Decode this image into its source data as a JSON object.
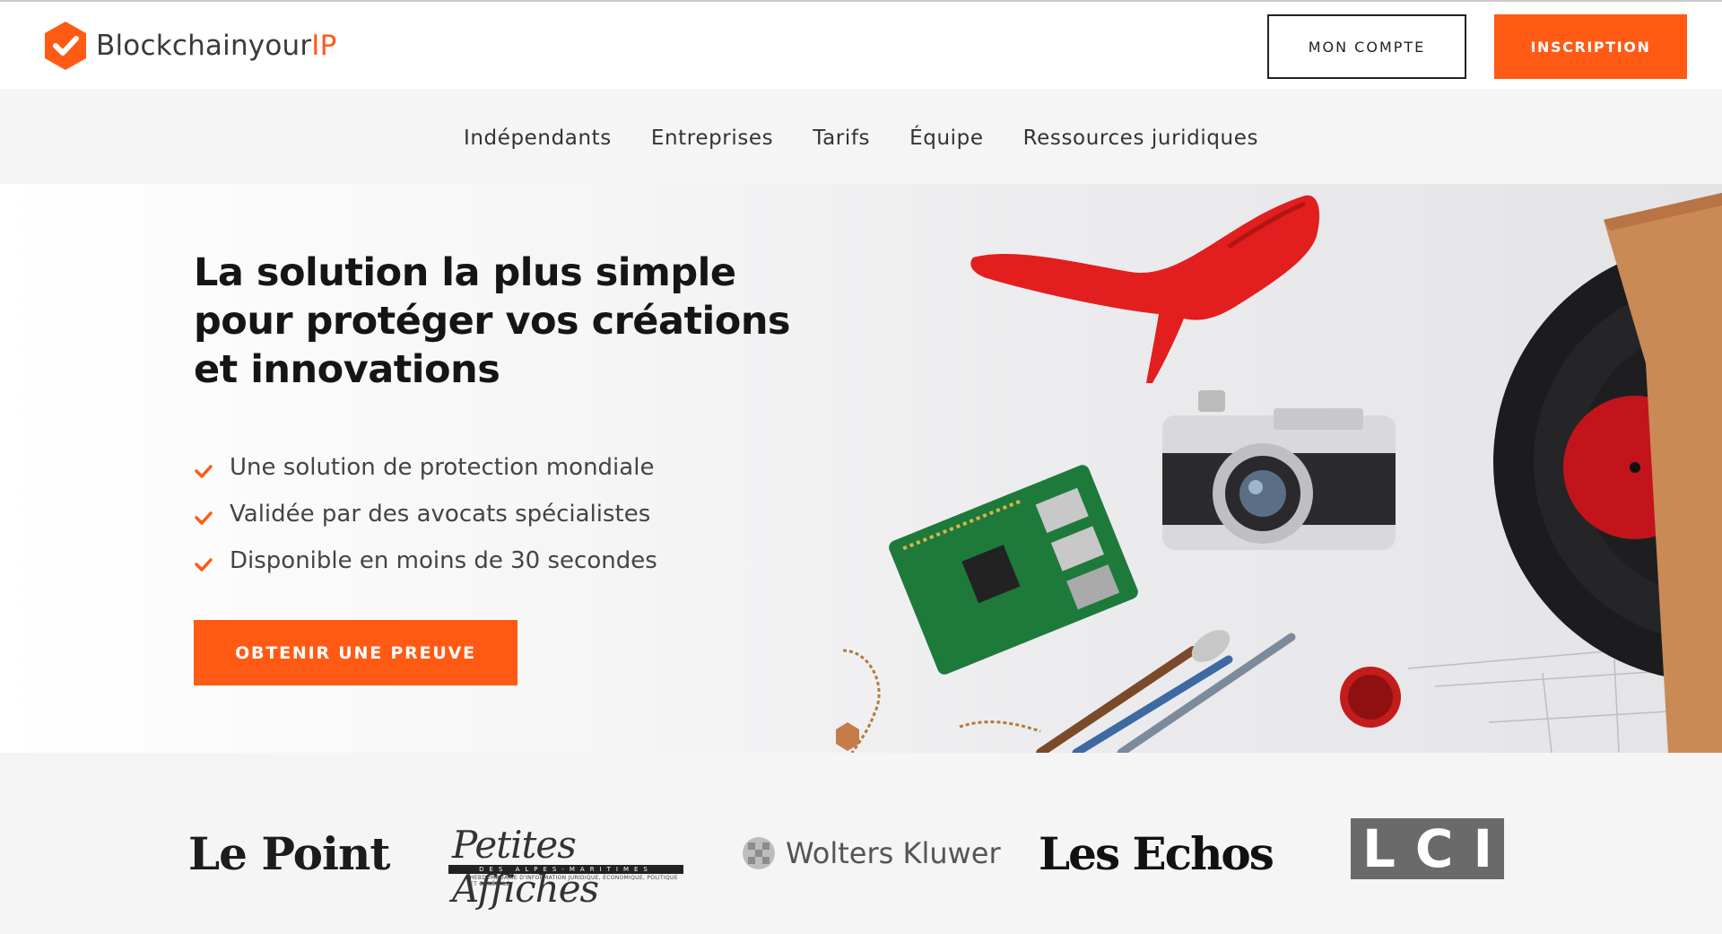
{
  "brand": {
    "name_main": "Blockchainyour",
    "name_accent": "IP",
    "accent_color": "#ff5a14"
  },
  "header": {
    "account_label": "MON COMPTE",
    "signup_label": "INSCRIPTION"
  },
  "nav": {
    "items": [
      "Indépendants",
      "Entreprises",
      "Tarifs",
      "Équipe",
      "Ressources juridiques"
    ]
  },
  "hero": {
    "title": "La solution la plus simple pour protéger vos créations et innovations",
    "features": [
      "Une solution de protection mondiale",
      "Validée par des avocats spécialistes",
      "Disponible en moins de 30 secondes"
    ],
    "cta_label": "OBTENIR UNE PREUVE"
  },
  "press": {
    "logos": [
      "Le Point",
      "Petites Affiches",
      "Wolters Kluwer",
      "Les Echos",
      "LCI"
    ],
    "petites_affiches_main": "Petites Affiches",
    "petites_affiches_sub": "DES ALPES-MARITIMES",
    "petites_affiches_tagline": "HEBDOMADAIRE D'INFORMATION JURIDIQUE, ÉCONOMIQUE, POLITIQUE ET GÉNÉRALE"
  },
  "icons": {
    "logo": "check-badge-icon",
    "feature": "checkmark-icon"
  }
}
